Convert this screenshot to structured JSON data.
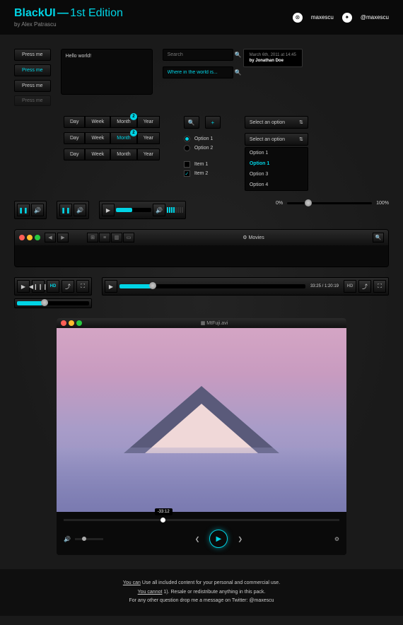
{
  "header": {
    "title": "BlackUI",
    "dash": "—",
    "edition": "1st Edition",
    "by": "by Alex Patrascu",
    "handle1": "maxescu",
    "handle2": "@maxescu"
  },
  "buttons": {
    "press": "Press me"
  },
  "textarea": {
    "text": "Hello world!"
  },
  "search": {
    "placeholder": "Search",
    "value": "Where in the world is..."
  },
  "tooltip": {
    "date": "March 6th, 2011 at 14:45",
    "author": "by Jonathan Doe"
  },
  "seg": {
    "day": "Day",
    "week": "Week",
    "month": "Month",
    "year": "Year",
    "badge": "2"
  },
  "radios": {
    "o1": "Option 1",
    "o2": "Option 2"
  },
  "checks": {
    "i1": "Item 1",
    "i2": "Item 2"
  },
  "select": {
    "label": "Select an option",
    "o1": "Option 1",
    "o3": "Option 3",
    "o4": "Option 4"
  },
  "slider": {
    "min": "0%",
    "max": "100%"
  },
  "finder": {
    "title": "Movies"
  },
  "video": {
    "time": "33:25 / 1:20:19",
    "hd": "HD"
  },
  "vplayer": {
    "title": "MtFuji.avi",
    "tip": "-33:12"
  },
  "footer": {
    "l1a": "You can",
    "l1b": " Use all included content for your personal and commercial use.",
    "l2a": "You cannot",
    "l2b": " 1). Resale or redistribute anything in this pack.",
    "l3": "For any other question drop me a message on Twitter: @maxescu"
  }
}
